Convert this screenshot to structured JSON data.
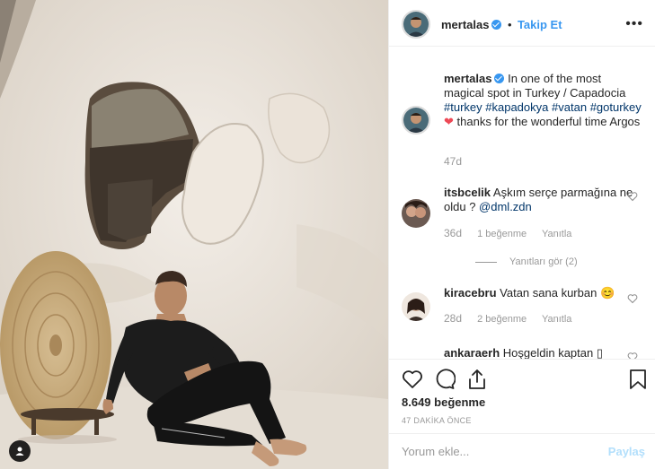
{
  "post": {
    "username": "mertalas",
    "follow_label": "Takip Et",
    "dot": "•",
    "more_label": "•••",
    "caption_user": "mertalas",
    "caption_1": " In one of the most magical spot in Turkey / Capadocia ",
    "caption_tags": [
      "#turkey",
      "#kapadokya",
      "#vatan",
      "#goturkey"
    ],
    "caption_2": " thanks for the wonderful time Argos",
    "caption_age": "47d",
    "likes": "8.649 beğenme",
    "date": "47 DAKİKA ÖNCE"
  },
  "comments": [
    {
      "user": "itsbcelik",
      "text": " Aşkım serçe parmağına ne oldu ? ",
      "mention": "@dml.zdn",
      "time": "36d",
      "likes": "1 beğenme",
      "reply": "Yanıtla",
      "view_replies": "Yanıtları gör (2)"
    },
    {
      "user": "kiracebru",
      "text": " Vatan sana kurban ",
      "emoji": "😊",
      "time": "28d",
      "likes": "2 beğenme",
      "reply": "Yanıtla"
    },
    {
      "user": "ankaraerh",
      "text": " Hoşgeldin kaptan ",
      "emoji": "▯"
    }
  ],
  "icons": {
    "like": "heart-icon",
    "comment": "comment-bubble-icon",
    "share": "share-icon",
    "save": "bookmark-icon",
    "user_tag": "user-tag-icon"
  },
  "comment_box": {
    "placeholder": "Yorum ekle...",
    "post_label": "Paylaş"
  },
  "colors": {
    "link": "#3897f0",
    "hashtag": "#003569",
    "heart": "#ed4956",
    "muted": "#999999",
    "post_disabled": "#b2dffc"
  }
}
